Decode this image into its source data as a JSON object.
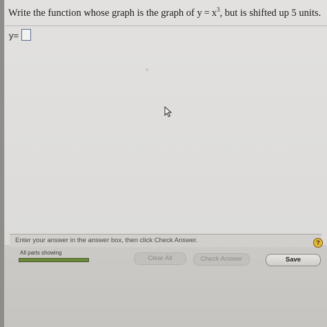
{
  "question": {
    "prefix": "Write the function whose graph is the graph of y = x",
    "exponent": "3",
    "suffix": ", but is shifted up 5 units."
  },
  "answer": {
    "label": "y=",
    "value": ""
  },
  "footer": {
    "instruction": "Enter your answer in the answer box, then click Check Answer.",
    "help_symbol": "?",
    "parts_label": "All parts showing",
    "clear_all_label": "Clear All",
    "check_answer_label": "Check Answer",
    "save_label": "Save"
  },
  "icons": {
    "cursor": "mouse-pointer-icon",
    "help": "help-icon"
  },
  "colors": {
    "help_icon": "#e3b93a",
    "progress_bar": "#6a8a3a",
    "answer_box_border": "#5a6b8a"
  }
}
